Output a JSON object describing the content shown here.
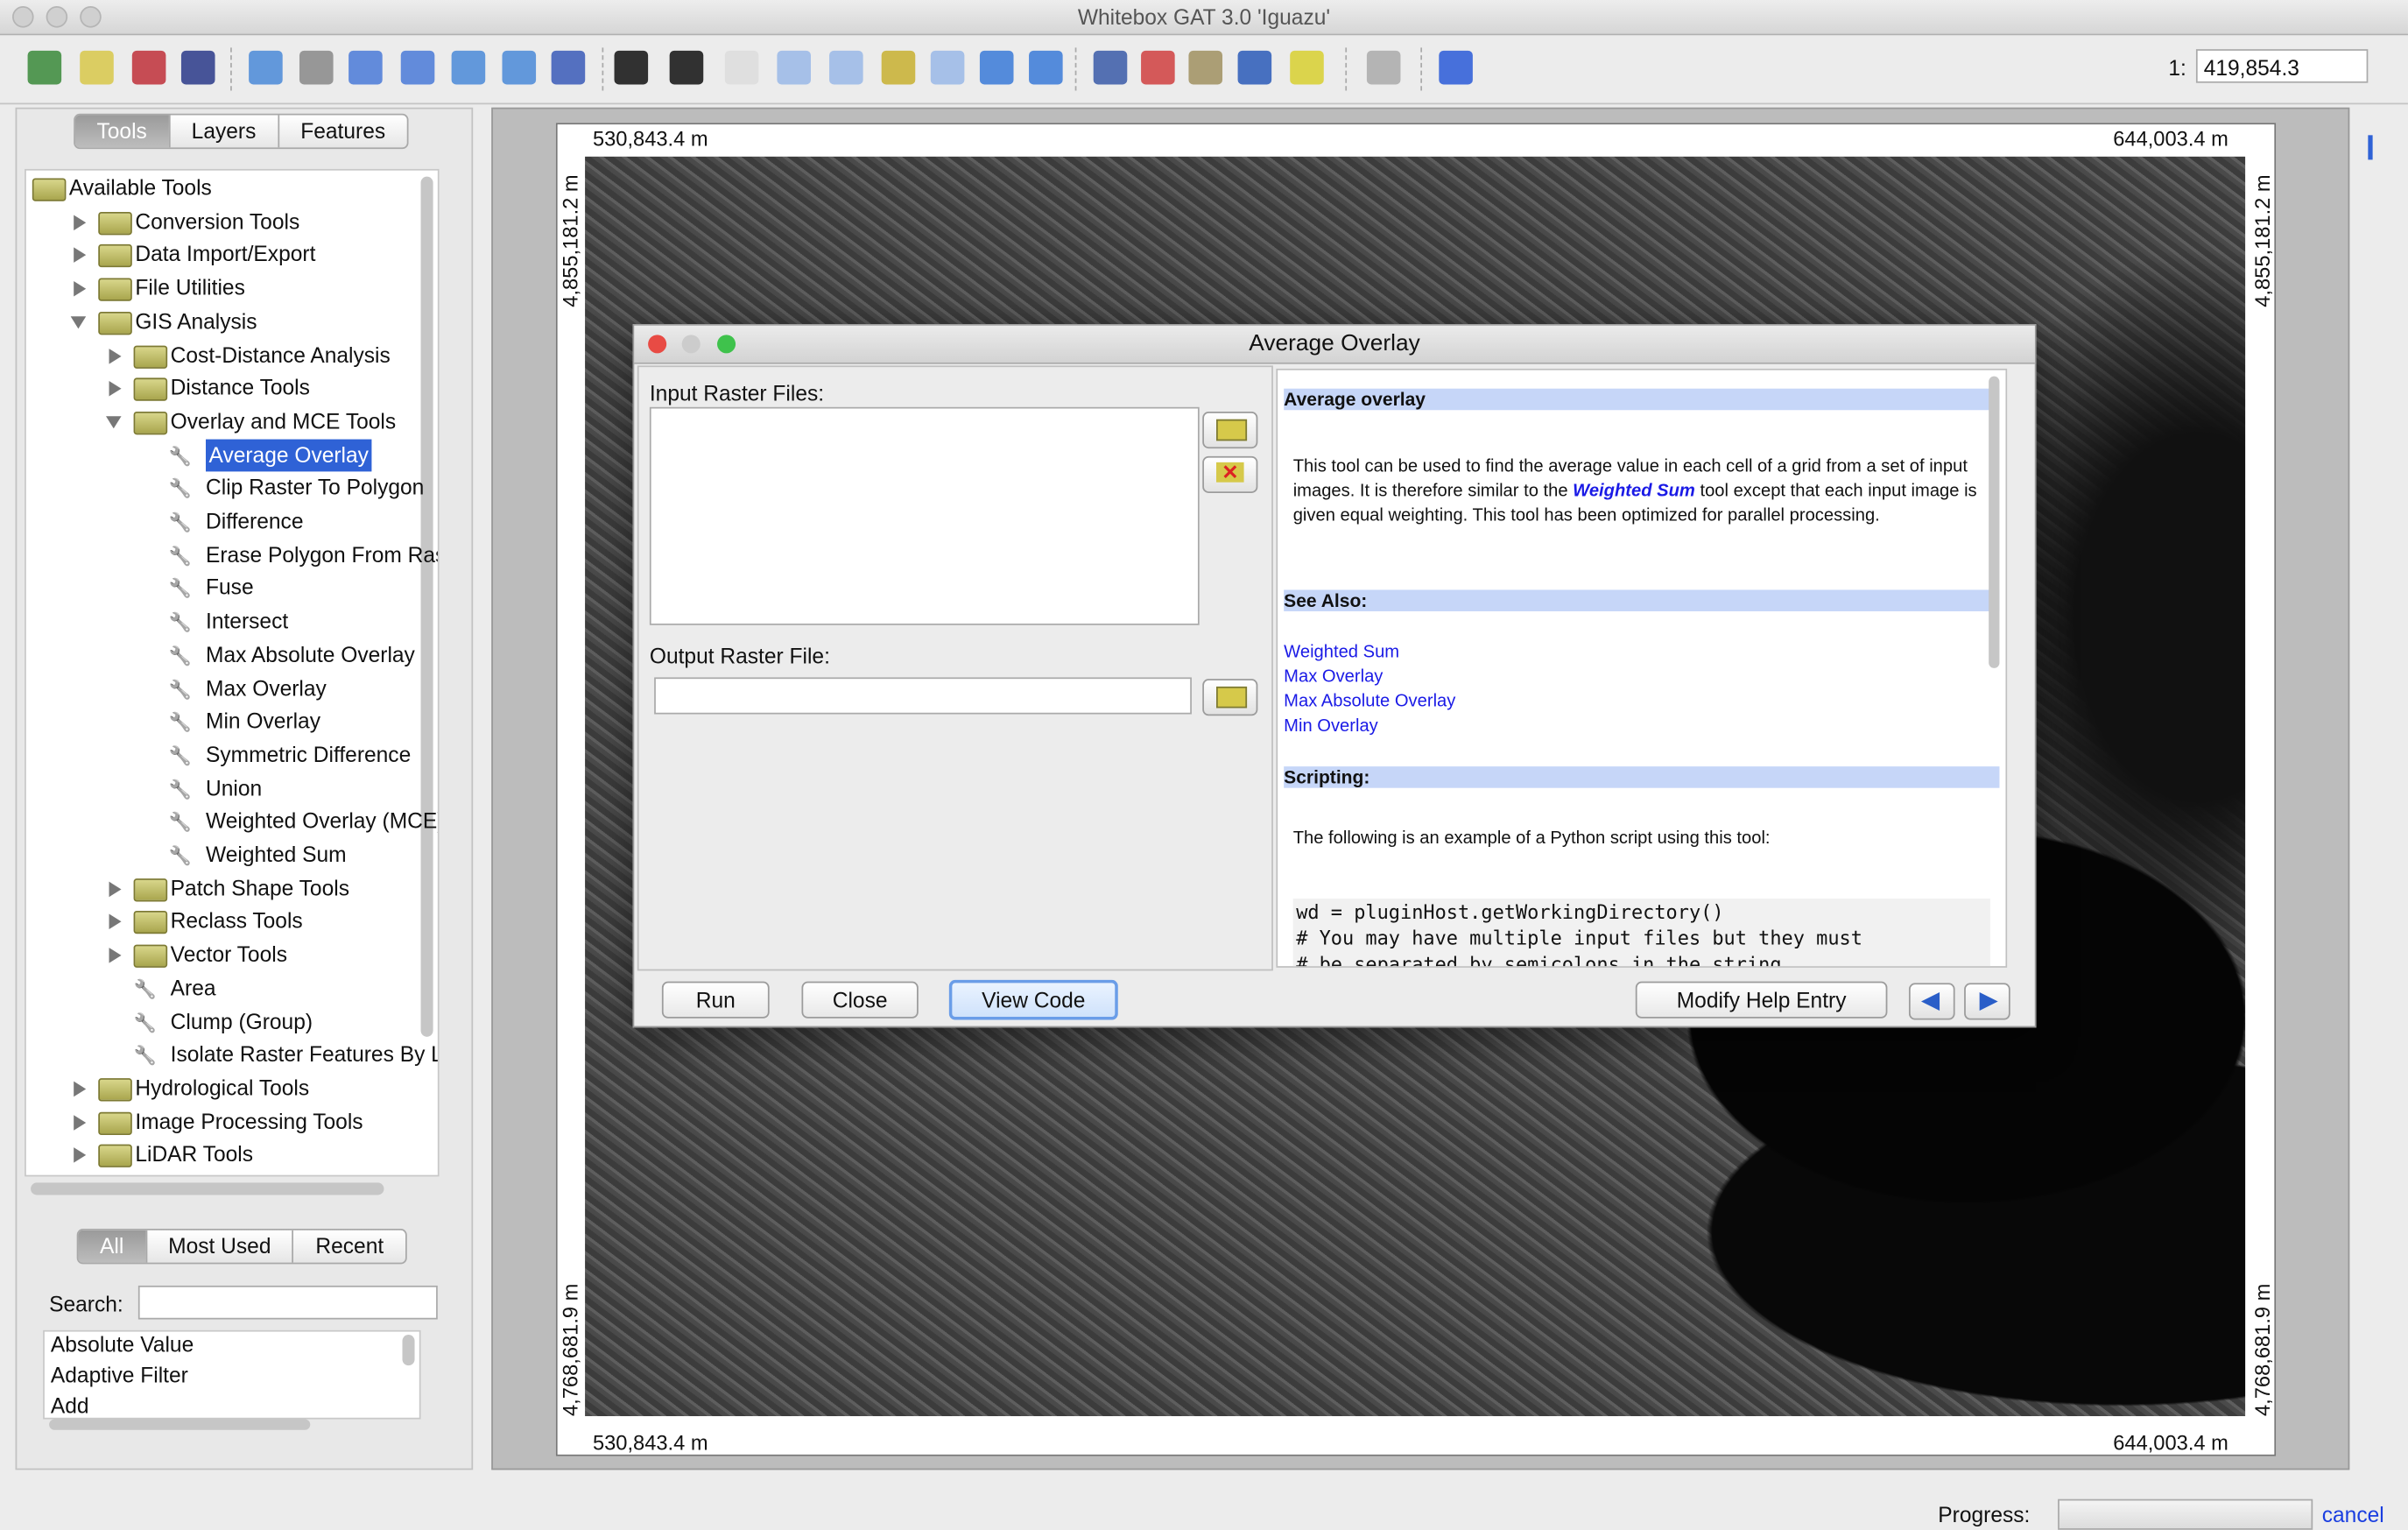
{
  "window": {
    "title": "Whitebox GAT 3.0 'Iguazu'"
  },
  "toolbar": {
    "icons": [
      "map-icon",
      "open-folder-icon",
      "save-icon",
      "print-icon",
      "add-layer-icon",
      "remove-layer-icon",
      "raise-layer-icon",
      "lower-layer-icon",
      "layer-to-top-icon",
      "layer-to-bottom-icon",
      "attribute-table-icon",
      "select-arrow-icon",
      "identify-arrow-icon",
      "pan-hand-icon",
      "zoom-in-icon",
      "zoom-out-icon",
      "full-extent-icon",
      "zoom-to-layer-icon",
      "previous-extent-icon",
      "next-extent-icon",
      "calculator-icon",
      "palette-icon",
      "scroll-icon",
      "digitize-icon",
      "ruler-icon",
      "line-profile-icon",
      "help-icon"
    ],
    "scale_prefix": "1:",
    "scale_value": "419,854.3"
  },
  "left_tabs": [
    {
      "label": "Tools",
      "active": true
    },
    {
      "label": "Layers",
      "active": false
    },
    {
      "label": "Features",
      "active": false
    }
  ],
  "tree": [
    {
      "label": "Available Tools",
      "level": 0,
      "type": "folder",
      "state": "none"
    },
    {
      "label": "Conversion Tools",
      "level": 1,
      "type": "folder",
      "state": "collapsed"
    },
    {
      "label": "Data Import/Export",
      "level": 1,
      "type": "folder",
      "state": "collapsed"
    },
    {
      "label": "File Utilities",
      "level": 1,
      "type": "folder",
      "state": "collapsed"
    },
    {
      "label": "GIS Analysis",
      "level": 1,
      "type": "folder",
      "state": "expanded"
    },
    {
      "label": "Cost-Distance Analysis",
      "level": 2,
      "type": "folder",
      "state": "collapsed"
    },
    {
      "label": "Distance Tools",
      "level": 2,
      "type": "folder",
      "state": "collapsed"
    },
    {
      "label": "Overlay and MCE Tools",
      "level": 2,
      "type": "folder",
      "state": "expanded"
    },
    {
      "label": "Average Overlay",
      "level": 3,
      "type": "tool",
      "selected": true
    },
    {
      "label": "Clip Raster To Polygon",
      "level": 3,
      "type": "tool"
    },
    {
      "label": "Difference",
      "level": 3,
      "type": "tool"
    },
    {
      "label": "Erase Polygon From Raster",
      "level": 3,
      "type": "tool"
    },
    {
      "label": "Fuse",
      "level": 3,
      "type": "tool"
    },
    {
      "label": "Intersect",
      "level": 3,
      "type": "tool"
    },
    {
      "label": "Max Absolute Overlay",
      "level": 3,
      "type": "tool"
    },
    {
      "label": "Max Overlay",
      "level": 3,
      "type": "tool"
    },
    {
      "label": "Min Overlay",
      "level": 3,
      "type": "tool"
    },
    {
      "label": "Symmetric Difference",
      "level": 3,
      "type": "tool"
    },
    {
      "label": "Union",
      "level": 3,
      "type": "tool"
    },
    {
      "label": "Weighted Overlay (MCE)",
      "level": 3,
      "type": "tool"
    },
    {
      "label": "Weighted Sum",
      "level": 3,
      "type": "tool"
    },
    {
      "label": "Patch Shape Tools",
      "level": 2,
      "type": "folder",
      "state": "collapsed"
    },
    {
      "label": "Reclass Tools",
      "level": 2,
      "type": "folder",
      "state": "collapsed"
    },
    {
      "label": "Vector Tools",
      "level": 2,
      "type": "folder",
      "state": "collapsed"
    },
    {
      "label": "Area",
      "level": 2,
      "type": "tool"
    },
    {
      "label": "Clump (Group)",
      "level": 2,
      "type": "tool"
    },
    {
      "label": "Isolate Raster Features By Location",
      "level": 2,
      "type": "tool"
    },
    {
      "label": "Hydrological Tools",
      "level": 1,
      "type": "folder",
      "state": "collapsed"
    },
    {
      "label": "Image Processing Tools",
      "level": 1,
      "type": "folder",
      "state": "collapsed"
    },
    {
      "label": "LiDAR Tools",
      "level": 1,
      "type": "folder",
      "state": "collapsed"
    }
  ],
  "lower_tabs": [
    {
      "label": "All",
      "active": true
    },
    {
      "label": "Most Used",
      "active": false
    },
    {
      "label": "Recent",
      "active": false
    }
  ],
  "search": {
    "label": "Search:",
    "value": ""
  },
  "tool_list": [
    "Absolute Value",
    "Adaptive Filter",
    "Add"
  ],
  "map": {
    "top_left_x": "530,843.4 m",
    "top_right_x": "644,003.4 m",
    "bottom_left_x": "530,843.4 m",
    "bottom_right_x": "644,003.4 m",
    "left_top_y": "4,855,181.2 m",
    "left_bottom_y": "4,768,681.9 m",
    "right_top_y": "4,855,181.2 m",
    "right_bottom_y": "4,768,681.9 m"
  },
  "dialog": {
    "title": "Average Overlay",
    "input_label": "Input Raster Files:",
    "output_label": "Output Raster File:",
    "output_value": "",
    "buttons": {
      "run": "Run",
      "close": "Close",
      "view_code": "View Code",
      "modify_help": "Modify Help Entry"
    },
    "help": {
      "heading": "Average overlay",
      "para_1": "This tool can be used to find the average value in each cell of a grid from a set of input images. It is therefore similar to the ",
      "para_link": "Weighted Sum",
      "para_2": " tool except that each input image is given equal weighting. This tool has been optimized for parallel processing.",
      "see_also_heading": "See Also:",
      "see_also": [
        "Weighted Sum",
        "Max Overlay",
        "Max Absolute Overlay",
        "Min Overlay"
      ],
      "scripting_heading": "Scripting:",
      "scripting_text": "The following is an example of a Python script using this tool:",
      "code": [
        "wd = pluginHost.getWorkingDirectory()",
        "# You may have multiple input files but they must",
        "# be separated by semicolons in the string."
      ]
    }
  },
  "status": {
    "progress_label": "Progress:",
    "progress": 0,
    "cancel": "cancel"
  },
  "colors": {
    "selection": "#2f62d6",
    "help_header": "#c6d6f8",
    "link": "#1a1ae6"
  }
}
